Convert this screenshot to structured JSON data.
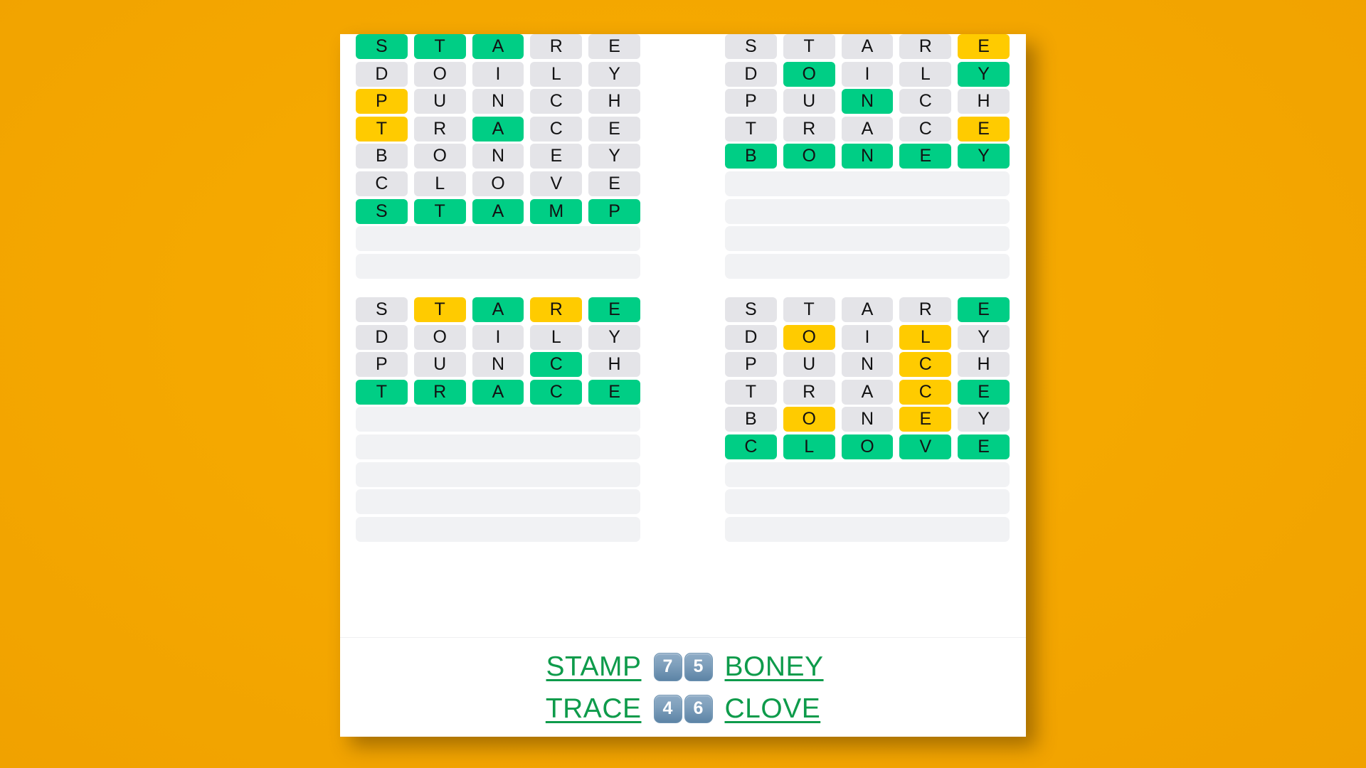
{
  "theme": {
    "background": "#F5A800",
    "card_background": "#FFFFFF",
    "tile_absent": "#E4E4E8",
    "tile_present": "#FFCB00",
    "tile_correct": "#00CE85",
    "tile_empty": "#F1F2F4",
    "link_green": "#0E9B4B",
    "badge_blue": "#7FA0BC"
  },
  "boards": [
    {
      "id": "board-top-left",
      "solution": "STAMP",
      "rows": [
        {
          "letters": [
            "S",
            "T",
            "A",
            "R",
            "E"
          ],
          "states": [
            "correct",
            "correct",
            "correct",
            "absent",
            "absent"
          ]
        },
        {
          "letters": [
            "D",
            "O",
            "I",
            "L",
            "Y"
          ],
          "states": [
            "absent",
            "absent",
            "absent",
            "absent",
            "absent"
          ]
        },
        {
          "letters": [
            "P",
            "U",
            "N",
            "C",
            "H"
          ],
          "states": [
            "present",
            "absent",
            "absent",
            "absent",
            "absent"
          ]
        },
        {
          "letters": [
            "T",
            "R",
            "A",
            "C",
            "E"
          ],
          "states": [
            "present",
            "absent",
            "correct",
            "absent",
            "absent"
          ]
        },
        {
          "letters": [
            "B",
            "O",
            "N",
            "E",
            "Y"
          ],
          "states": [
            "absent",
            "absent",
            "absent",
            "absent",
            "absent"
          ]
        },
        {
          "letters": [
            "C",
            "L",
            "O",
            "V",
            "E"
          ],
          "states": [
            "absent",
            "absent",
            "absent",
            "absent",
            "absent"
          ]
        },
        {
          "letters": [
            "S",
            "T",
            "A",
            "M",
            "P"
          ],
          "states": [
            "correct",
            "correct",
            "correct",
            "correct",
            "correct"
          ]
        },
        {
          "letters": [
            "",
            "",
            "",
            "",
            ""
          ],
          "states": [
            "empty",
            "empty",
            "empty",
            "empty",
            "empty"
          ]
        },
        {
          "letters": [
            "",
            "",
            "",
            "",
            ""
          ],
          "states": [
            "empty",
            "empty",
            "empty",
            "empty",
            "empty"
          ]
        }
      ]
    },
    {
      "id": "board-top-right",
      "solution": "BONEY",
      "rows": [
        {
          "letters": [
            "S",
            "T",
            "A",
            "R",
            "E"
          ],
          "states": [
            "absent",
            "absent",
            "absent",
            "absent",
            "present"
          ]
        },
        {
          "letters": [
            "D",
            "O",
            "I",
            "L",
            "Y"
          ],
          "states": [
            "absent",
            "correct",
            "absent",
            "absent",
            "correct"
          ]
        },
        {
          "letters": [
            "P",
            "U",
            "N",
            "C",
            "H"
          ],
          "states": [
            "absent",
            "absent",
            "correct",
            "absent",
            "absent"
          ]
        },
        {
          "letters": [
            "T",
            "R",
            "A",
            "C",
            "E"
          ],
          "states": [
            "absent",
            "absent",
            "absent",
            "absent",
            "present"
          ]
        },
        {
          "letters": [
            "B",
            "O",
            "N",
            "E",
            "Y"
          ],
          "states": [
            "correct",
            "correct",
            "correct",
            "correct",
            "correct"
          ]
        },
        {
          "letters": [
            "",
            "",
            "",
            "",
            ""
          ],
          "states": [
            "empty",
            "empty",
            "empty",
            "empty",
            "empty"
          ]
        },
        {
          "letters": [
            "",
            "",
            "",
            "",
            ""
          ],
          "states": [
            "empty",
            "empty",
            "empty",
            "empty",
            "empty"
          ]
        },
        {
          "letters": [
            "",
            "",
            "",
            "",
            ""
          ],
          "states": [
            "empty",
            "empty",
            "empty",
            "empty",
            "empty"
          ]
        },
        {
          "letters": [
            "",
            "",
            "",
            "",
            ""
          ],
          "states": [
            "empty",
            "empty",
            "empty",
            "empty",
            "empty"
          ]
        }
      ]
    },
    {
      "id": "board-bottom-left",
      "solution": "TRACE",
      "rows": [
        {
          "letters": [
            "S",
            "T",
            "A",
            "R",
            "E"
          ],
          "states": [
            "absent",
            "present",
            "correct",
            "present",
            "correct"
          ]
        },
        {
          "letters": [
            "D",
            "O",
            "I",
            "L",
            "Y"
          ],
          "states": [
            "absent",
            "absent",
            "absent",
            "absent",
            "absent"
          ]
        },
        {
          "letters": [
            "P",
            "U",
            "N",
            "C",
            "H"
          ],
          "states": [
            "absent",
            "absent",
            "absent",
            "correct",
            "absent"
          ]
        },
        {
          "letters": [
            "T",
            "R",
            "A",
            "C",
            "E"
          ],
          "states": [
            "correct",
            "correct",
            "correct",
            "correct",
            "correct"
          ]
        },
        {
          "letters": [
            "",
            "",
            "",
            "",
            ""
          ],
          "states": [
            "empty",
            "empty",
            "empty",
            "empty",
            "empty"
          ]
        },
        {
          "letters": [
            "",
            "",
            "",
            "",
            ""
          ],
          "states": [
            "empty",
            "empty",
            "empty",
            "empty",
            "empty"
          ]
        },
        {
          "letters": [
            "",
            "",
            "",
            "",
            ""
          ],
          "states": [
            "empty",
            "empty",
            "empty",
            "empty",
            "empty"
          ]
        },
        {
          "letters": [
            "",
            "",
            "",
            "",
            ""
          ],
          "states": [
            "empty",
            "empty",
            "empty",
            "empty",
            "empty"
          ]
        },
        {
          "letters": [
            "",
            "",
            "",
            "",
            ""
          ],
          "states": [
            "empty",
            "empty",
            "empty",
            "empty",
            "empty"
          ]
        }
      ]
    },
    {
      "id": "board-bottom-right",
      "solution": "CLOVE",
      "rows": [
        {
          "letters": [
            "S",
            "T",
            "A",
            "R",
            "E"
          ],
          "states": [
            "absent",
            "absent",
            "absent",
            "absent",
            "correct"
          ]
        },
        {
          "letters": [
            "D",
            "O",
            "I",
            "L",
            "Y"
          ],
          "states": [
            "absent",
            "present",
            "absent",
            "present",
            "absent"
          ]
        },
        {
          "letters": [
            "P",
            "U",
            "N",
            "C",
            "H"
          ],
          "states": [
            "absent",
            "absent",
            "absent",
            "present",
            "absent"
          ]
        },
        {
          "letters": [
            "T",
            "R",
            "A",
            "C",
            "E"
          ],
          "states": [
            "absent",
            "absent",
            "absent",
            "present",
            "correct"
          ]
        },
        {
          "letters": [
            "B",
            "O",
            "N",
            "E",
            "Y"
          ],
          "states": [
            "absent",
            "present",
            "absent",
            "present",
            "absent"
          ]
        },
        {
          "letters": [
            "C",
            "L",
            "O",
            "V",
            "E"
          ],
          "states": [
            "correct",
            "correct",
            "correct",
            "correct",
            "correct"
          ]
        },
        {
          "letters": [
            "",
            "",
            "",
            "",
            ""
          ],
          "states": [
            "empty",
            "empty",
            "empty",
            "empty",
            "empty"
          ]
        },
        {
          "letters": [
            "",
            "",
            "",
            "",
            ""
          ],
          "states": [
            "empty",
            "empty",
            "empty",
            "empty",
            "empty"
          ]
        },
        {
          "letters": [
            "",
            "",
            "",
            "",
            ""
          ],
          "states": [
            "empty",
            "empty",
            "empty",
            "empty",
            "empty"
          ]
        }
      ]
    }
  ],
  "summary": {
    "rows": [
      {
        "left_word": "STAMP",
        "left_guesses": "7",
        "right_guesses": "5",
        "right_word": "BONEY"
      },
      {
        "left_word": "TRACE",
        "left_guesses": "4",
        "right_guesses": "6",
        "right_word": "CLOVE"
      }
    ]
  }
}
